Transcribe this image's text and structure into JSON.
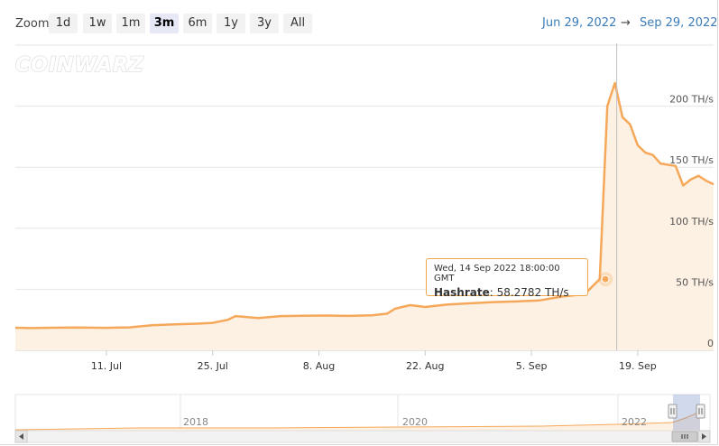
{
  "zoom": {
    "label": "Zoom",
    "buttons": [
      "1d",
      "1w",
      "1m",
      "3m",
      "6m",
      "1y",
      "3y",
      "All"
    ],
    "active": "3m"
  },
  "range": {
    "from": "Jun 29, 2022",
    "arrow": "→",
    "to": "Sep 29, 2022"
  },
  "watermark": "CoinWarz",
  "tooltip": {
    "date": "Wed, 14 Sep 2022 18:00:00 GMT",
    "series_name": "Hashrate",
    "value_text": "58.2782 TH/s"
  },
  "colors": {
    "line": "#f5a85a",
    "fill": "#fdf1e4",
    "grid": "#e6e6e6",
    "accent": "#3c7cb8"
  },
  "navigator": {
    "year_labels": [
      "2018",
      "2020",
      "2022"
    ]
  },
  "chart_data": {
    "type": "area",
    "series": [
      {
        "name": "Hashrate",
        "unit": "TH/s",
        "x": [
          "2022-06-29",
          "2022-07-01",
          "2022-07-04",
          "2022-07-07",
          "2022-07-11",
          "2022-07-14",
          "2022-07-17",
          "2022-07-20",
          "2022-07-23",
          "2022-07-25",
          "2022-07-27",
          "2022-07-28",
          "2022-07-31",
          "2022-08-03",
          "2022-08-06",
          "2022-08-09",
          "2022-08-12",
          "2022-08-15",
          "2022-08-17",
          "2022-08-18",
          "2022-08-20",
          "2022-08-22",
          "2022-08-25",
          "2022-08-28",
          "2022-08-31",
          "2022-09-03",
          "2022-09-06",
          "2022-09-09",
          "2022-09-12",
          "2022-09-14",
          "2022-09-15",
          "2022-09-16",
          "2022-09-17",
          "2022-09-18",
          "2022-09-19",
          "2022-09-20",
          "2022-09-21",
          "2022-09-22",
          "2022-09-23",
          "2022-09-24",
          "2022-09-25",
          "2022-09-26",
          "2022-09-27",
          "2022-09-28",
          "2022-09-29"
        ],
        "y": [
          18.5,
          18.2,
          18.5,
          18.7,
          18.4,
          18.8,
          20.5,
          21.3,
          21.8,
          22.5,
          25.0,
          28.0,
          26.5,
          28.0,
          28.3,
          28.5,
          28.2,
          28.7,
          30.0,
          34.0,
          37.0,
          35.5,
          37.5,
          38.5,
          39.5,
          40.0,
          40.8,
          44.0,
          46.0,
          58.2782,
          200.0,
          219.0,
          191.0,
          185.0,
          168.0,
          162.0,
          160.0,
          153.0,
          152.0,
          151.0,
          135.0,
          140.0,
          143.0,
          139.0,
          136.0
        ]
      }
    ],
    "x_tick_labels": [
      "11. Jul",
      "25. Jul",
      "8. Aug",
      "22. Aug",
      "5. Sep",
      "19. Sep"
    ],
    "x_ticks": [
      "2022-07-11",
      "2022-07-25",
      "2022-08-08",
      "2022-08-22",
      "2022-09-05",
      "2022-09-19"
    ],
    "y_tick_labels": [
      "0",
      "50 TH/s",
      "100 TH/s",
      "150 TH/s",
      "200 TH/s"
    ],
    "y_ticks": [
      0,
      50,
      100,
      150,
      200
    ],
    "xlim": [
      "2022-06-29",
      "2022-09-29"
    ],
    "ylim": [
      0,
      250
    ],
    "grid": "horizontal",
    "legend": "none"
  }
}
